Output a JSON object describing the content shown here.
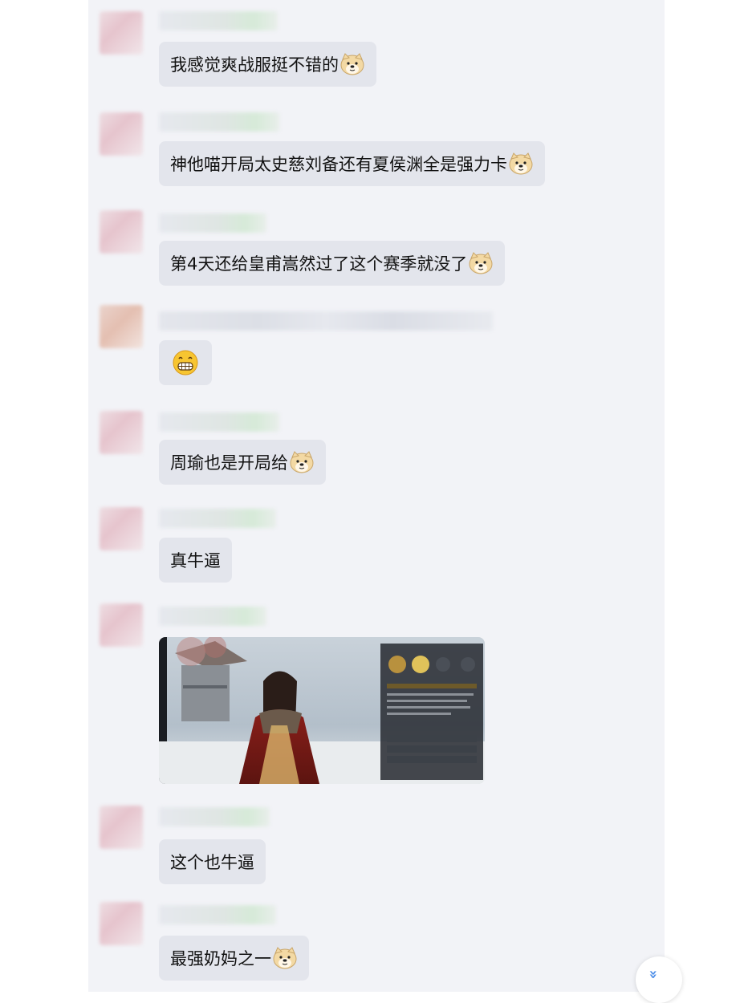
{
  "messages": [
    {
      "type": "text",
      "text": "我感觉爽战服挺不错的",
      "emoji": "doge-icon"
    },
    {
      "type": "text",
      "text": "神他喵开局太史慈刘备还有夏侯渊全是强力卡",
      "emoji": "doge-icon"
    },
    {
      "type": "text",
      "text": "第4天还给皇甫嵩然过了这个赛季就没了",
      "emoji": "doge-icon"
    },
    {
      "type": "emoji",
      "emoji": "grin-icon"
    },
    {
      "type": "text",
      "text": "周瑜也是开局给",
      "emoji": "doge-icon"
    },
    {
      "type": "text",
      "text": "真牛逼"
    },
    {
      "type": "image",
      "content": "game-hero-screenshot"
    },
    {
      "type": "text",
      "text": "这个也牛逼"
    },
    {
      "type": "text",
      "text": "最强奶妈之一",
      "emoji": "doge-icon"
    }
  ],
  "scroll_button": {
    "icon": "double-chevron-down-icon",
    "glyph": "»"
  },
  "colors": {
    "panel_bg": "#f2f3f7",
    "bubble_bg": "#e3e5ec",
    "text": "#111111",
    "accent": "#4d8ee8"
  }
}
